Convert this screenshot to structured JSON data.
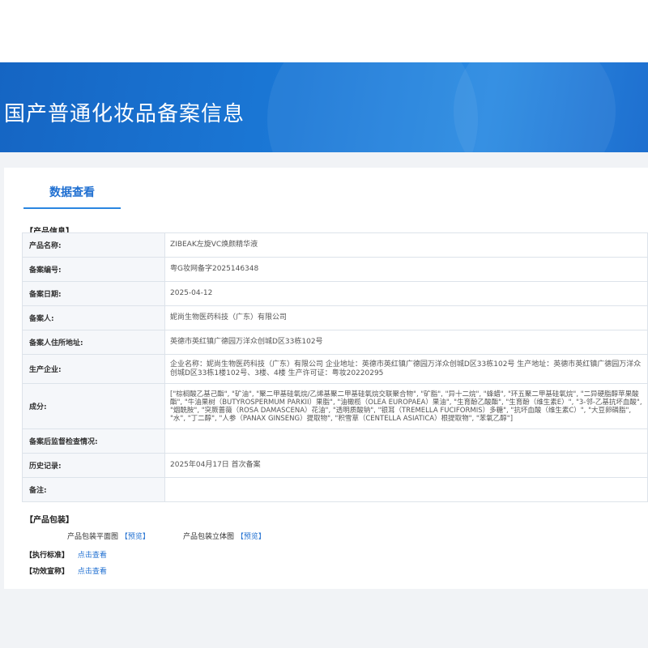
{
  "header": {
    "title": "国产普通化妆品备案信息"
  },
  "tabs": [
    {
      "label": "数据查看",
      "active": true
    }
  ],
  "product_info": {
    "section_label": "【产品信息】",
    "rows": [
      {
        "key": "产品名称:",
        "value": "ZIBEAK左旋VC焕颜精华液"
      },
      {
        "key": "备案编号:",
        "value": "粤G妆网备字2025146348"
      },
      {
        "key": "备案日期:",
        "value": "2025-04-12"
      },
      {
        "key": "备案人:",
        "value": "妮尚生物医药科技（广东）有限公司"
      },
      {
        "key": "备案人住所地址:",
        "value": "英德市英红镇广德园万洋众创城D区33栋102号"
      },
      {
        "key": "生产企业:",
        "value": "企业名称：妮尚生物医药科技（广东）有限公司 企业地址：英德市英红镇广德园万洋众创城D区33栋102号 生产地址：英德市英红镇广德园万洋众创城D区33栋1楼102号、3楼、4楼 生产许可证：粤妆20220295"
      },
      {
        "key": "成分:",
        "value": "[\"棕榈酸乙基己酯\", \"矿油\", \"聚二甲基硅氧烷/乙烯基聚二甲基硅氧烷交联聚合物\", \"矿脂\", \"异十二烷\", \"蜂蜡\", \"环五聚二甲基硅氧烷\", \"二异硬脂醇苹果酸酯\", \"牛油果树（BUTYROSPERMUM PARKII）果脂\", \"油橄榄（OLEA EUROPAEA）果油\", \"生育酚乙酸酯\", \"生育酚（维生素E）\", \"3-邻-乙基抗坏血酸\", \"烟酰胺\", \"突厥蔷薇（ROSA DAMASCENA）花油\", \"透明质酸钠\", \"银耳（TREMELLA FUCIFORMIS）多糖\", \"抗坏血酸（维生素C）\", \"大豆卵磷脂\", \"水\", \"丁二醇\", \"人参（PANAX GINSENG）提取物\", \"积雪草（CENTELLA ASIATICA）根提取物\", \"苯氧乙醇\"]"
      },
      {
        "key": "备案后监督检查情况:",
        "value": ""
      },
      {
        "key": "历史记录:",
        "value": "2025年04月17日 首次备案"
      },
      {
        "key": "备注:",
        "value": ""
      }
    ]
  },
  "packaging": {
    "section_label": "【产品包装】",
    "items": [
      {
        "label": "产品包装平面图",
        "link": "【预览】"
      },
      {
        "label": "产品包装立体图",
        "link": "【预览】"
      }
    ]
  },
  "standards": {
    "label": "【执行标准】",
    "link": "点击查看"
  },
  "efficacy": {
    "label": "【功效宣称】",
    "link": "点击查看"
  }
}
